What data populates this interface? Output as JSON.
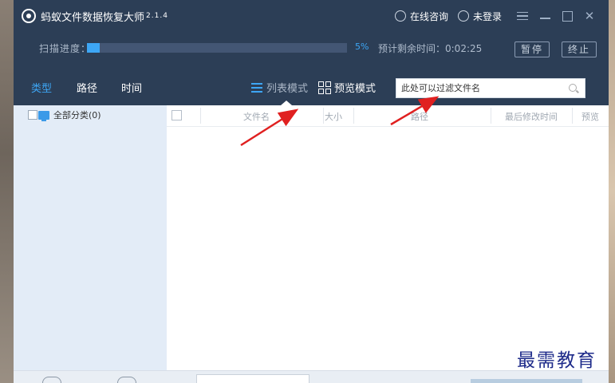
{
  "app": {
    "title": "蚂蚁文件数据恢复大师",
    "version": "2.1.4"
  },
  "titlebar": {
    "online_consult": "在线咨询",
    "not_logged_in": "未登录"
  },
  "progress": {
    "label": "扫描进度：",
    "percent_value": 5,
    "percent_text": "5%",
    "remaining": "预计剩余时间：0:02:25",
    "pause_label": "暂停",
    "stop_label": "终止"
  },
  "nav": {
    "tabs": [
      {
        "label": "类型",
        "active": true
      },
      {
        "label": "路径",
        "active": false
      },
      {
        "label": "时间",
        "active": false
      }
    ],
    "list_mode": "列表模式",
    "preview_mode": "预览模式",
    "search_placeholder": "此处可以过滤文件名"
  },
  "sidebar": {
    "category": "全部分类(0)"
  },
  "table": {
    "columns": [
      "文件名",
      "大小",
      "路径",
      "最后修改时间",
      "预览"
    ]
  },
  "watermark": "最需教育",
  "colors": {
    "titlebar_bg": "#2c3e56",
    "accent": "#3da6f5",
    "sidebar_bg": "#e3ecf7",
    "annotation_arrow": "#e02020"
  },
  "icons": [
    "app-logo-icon",
    "chat-icon",
    "user-icon",
    "menu-icon",
    "minimize-icon",
    "maximize-icon",
    "close-icon",
    "list-icon",
    "grid-icon",
    "search-icon",
    "monitor-icon"
  ]
}
